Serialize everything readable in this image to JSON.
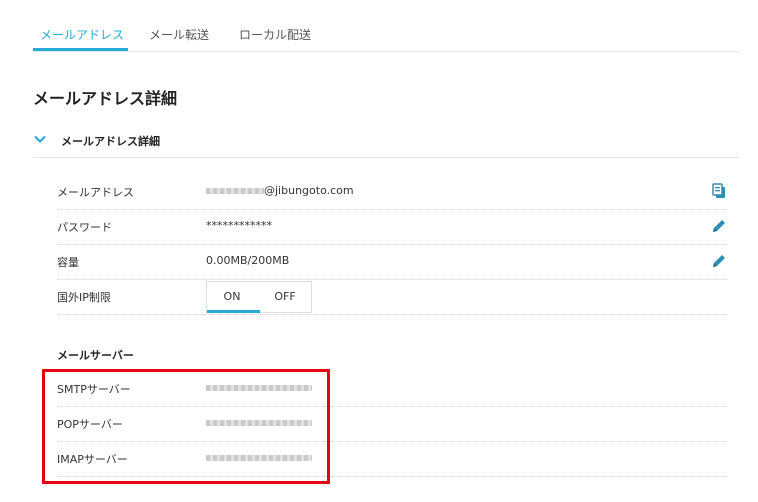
{
  "tabs": [
    {
      "label": "メールアドレス",
      "active": true
    },
    {
      "label": "メール転送",
      "active": false
    },
    {
      "label": "ローカル配送",
      "active": false
    }
  ],
  "page_title": "メールアドレス詳細",
  "section": {
    "label": "メールアドレス詳細",
    "expanded": true
  },
  "details": {
    "email": {
      "label": "メールアドレス",
      "value_domain": "@jibungoto.com",
      "action_icon": "copy-icon"
    },
    "password": {
      "label": "パスワード",
      "value": "************",
      "action_icon": "pencil-icon"
    },
    "capacity": {
      "label": "容量",
      "value": "0.00MB/200MB",
      "action_icon": "pencil-icon"
    },
    "foreign_ip": {
      "label": "国外IP制限",
      "on_label": "ON",
      "off_label": "OFF",
      "selected": "ON"
    }
  },
  "mail_server": {
    "heading": "メールサーバー",
    "rows": [
      {
        "label": "SMTPサーバー"
      },
      {
        "label": "POPサーバー"
      },
      {
        "label": "IMAPサーバー"
      }
    ]
  },
  "colors": {
    "accent": "#29a9d6",
    "highlight": "#e60012",
    "divider": "#e6e6e6",
    "icon": "#2e8fb5"
  }
}
